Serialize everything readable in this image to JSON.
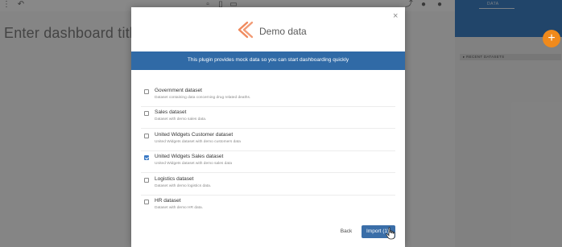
{
  "app": {
    "dashboard_title_placeholder": "Enter dashboard title",
    "right_panel_tab": "DATA",
    "recent_datasets_label": "▸ RECENT DATASETS",
    "fab_symbol": "+"
  },
  "modal": {
    "brand_text": "Demo data",
    "close_symbol": "×",
    "banner_text": "This plugin provides mock data so you can start dashboarding quickly",
    "datasets": [
      {
        "name": "Government dataset",
        "description": "Dataset containing data concerning drug related deaths.",
        "checked": false
      },
      {
        "name": "Sales dataset",
        "description": "Dataset with demo sales data.",
        "checked": false
      },
      {
        "name": "United Widgets Customer dataset",
        "description": "United Widgets dataset with demo customers data",
        "checked": false
      },
      {
        "name": "United Widgets Sales dataset",
        "description": "United Widgets dataset with demo sales data",
        "checked": true
      },
      {
        "name": "Logistics dataset",
        "description": "Dataset with demo logistics data.",
        "checked": false
      },
      {
        "name": "HR dataset",
        "description": "Dataset with demo HR data.",
        "checked": false
      }
    ],
    "back_label": "Back",
    "import_label": "Import (1)"
  },
  "colors": {
    "banner": "#306aa6",
    "accent_orange": "#f08a1c",
    "checkbox_checked": "#3a79c5",
    "import_button": "#3a6ea8"
  }
}
